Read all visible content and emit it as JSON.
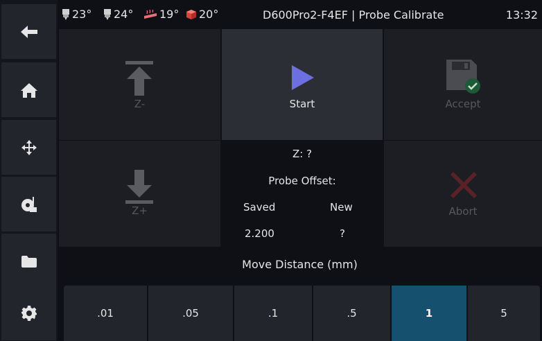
{
  "header": {
    "temps": [
      {
        "icon": "extruder-icon",
        "value": "23°"
      },
      {
        "icon": "extruder-icon",
        "value": "24°"
      },
      {
        "icon": "heated-bed-icon",
        "value": "19°"
      },
      {
        "icon": "chamber-cube-icon",
        "value": "20°"
      }
    ],
    "title": "D600Pro2-F4EF | Probe Calibrate",
    "time": "13:32"
  },
  "sidebar": {
    "items": [
      {
        "icon": "back-arrow-icon"
      },
      {
        "icon": "home-icon"
      },
      {
        "icon": "move-icon"
      },
      {
        "icon": "extrude-spool-icon"
      },
      {
        "icon": "folder-icon"
      },
      {
        "icon": "gear-icon"
      }
    ]
  },
  "controls": {
    "z_up_label": "Z-",
    "z_down_label": "Z+",
    "start_label": "Start",
    "accept_label": "Accept",
    "abort_label": "Abort"
  },
  "info": {
    "z": "Z: ?",
    "probe_offset": "Probe Offset:",
    "saved_label": "Saved",
    "new_label": "New",
    "saved_value": "2.200",
    "new_value": "?"
  },
  "move_distance": {
    "label": "Move Distance (mm)",
    "options": [
      ".01",
      ".05",
      ".1",
      ".5",
      "1",
      "5"
    ],
    "selected": "1"
  },
  "colors": {
    "accent": "#16506f",
    "start_icon": "#6b6fe0",
    "accept_check": "#2a7a4a",
    "abort_x": "#5a2226"
  }
}
